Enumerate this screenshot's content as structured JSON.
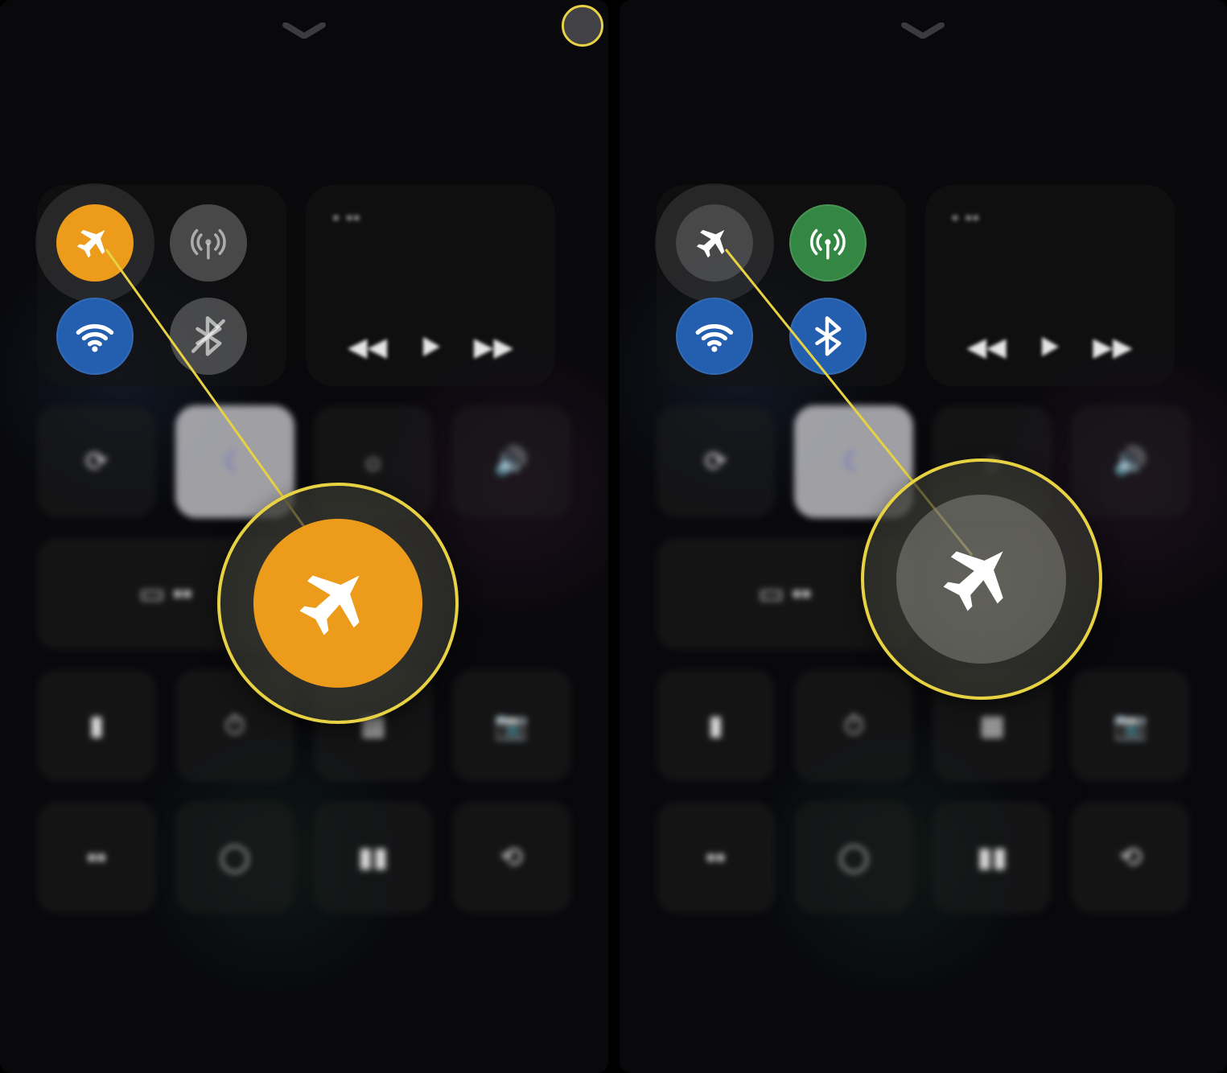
{
  "panes": [
    {
      "id": "airplane-on",
      "corner_highlight": true,
      "connectivity": {
        "airplane": {
          "state": "on",
          "icon": "airplane-icon",
          "color": "orange",
          "halo": true
        },
        "cellular": {
          "state": "off",
          "icon": "cellular-icon",
          "color": "off"
        },
        "wifi": {
          "state": "on",
          "icon": "wifi-icon",
          "color": "blue"
        },
        "bluetooth": {
          "state": "off",
          "icon": "bluetooth-off-icon",
          "color": "off"
        }
      },
      "callout": {
        "icon": "airplane-icon",
        "state": "on",
        "color": "orange"
      }
    },
    {
      "id": "airplane-off",
      "corner_highlight": false,
      "connectivity": {
        "airplane": {
          "state": "off",
          "icon": "airplane-icon",
          "color": "off",
          "halo": true
        },
        "cellular": {
          "state": "on",
          "icon": "cellular-icon",
          "color": "green"
        },
        "wifi": {
          "state": "on",
          "icon": "wifi-icon",
          "color": "blue"
        },
        "bluetooth": {
          "state": "on",
          "icon": "bluetooth-icon",
          "color": "blue"
        }
      },
      "callout": {
        "icon": "airplane-icon",
        "state": "off",
        "color": "off"
      }
    }
  ],
  "media": {
    "nowplaying_placeholder": "▪ ▪▪"
  },
  "icons": {
    "airplane-icon": "airplane",
    "cellular-icon": "antenna",
    "wifi-icon": "wifi",
    "bluetooth-icon": "bluetooth",
    "bluetooth-off-icon": "bluetooth-off"
  },
  "annotation_color": "#ead335"
}
